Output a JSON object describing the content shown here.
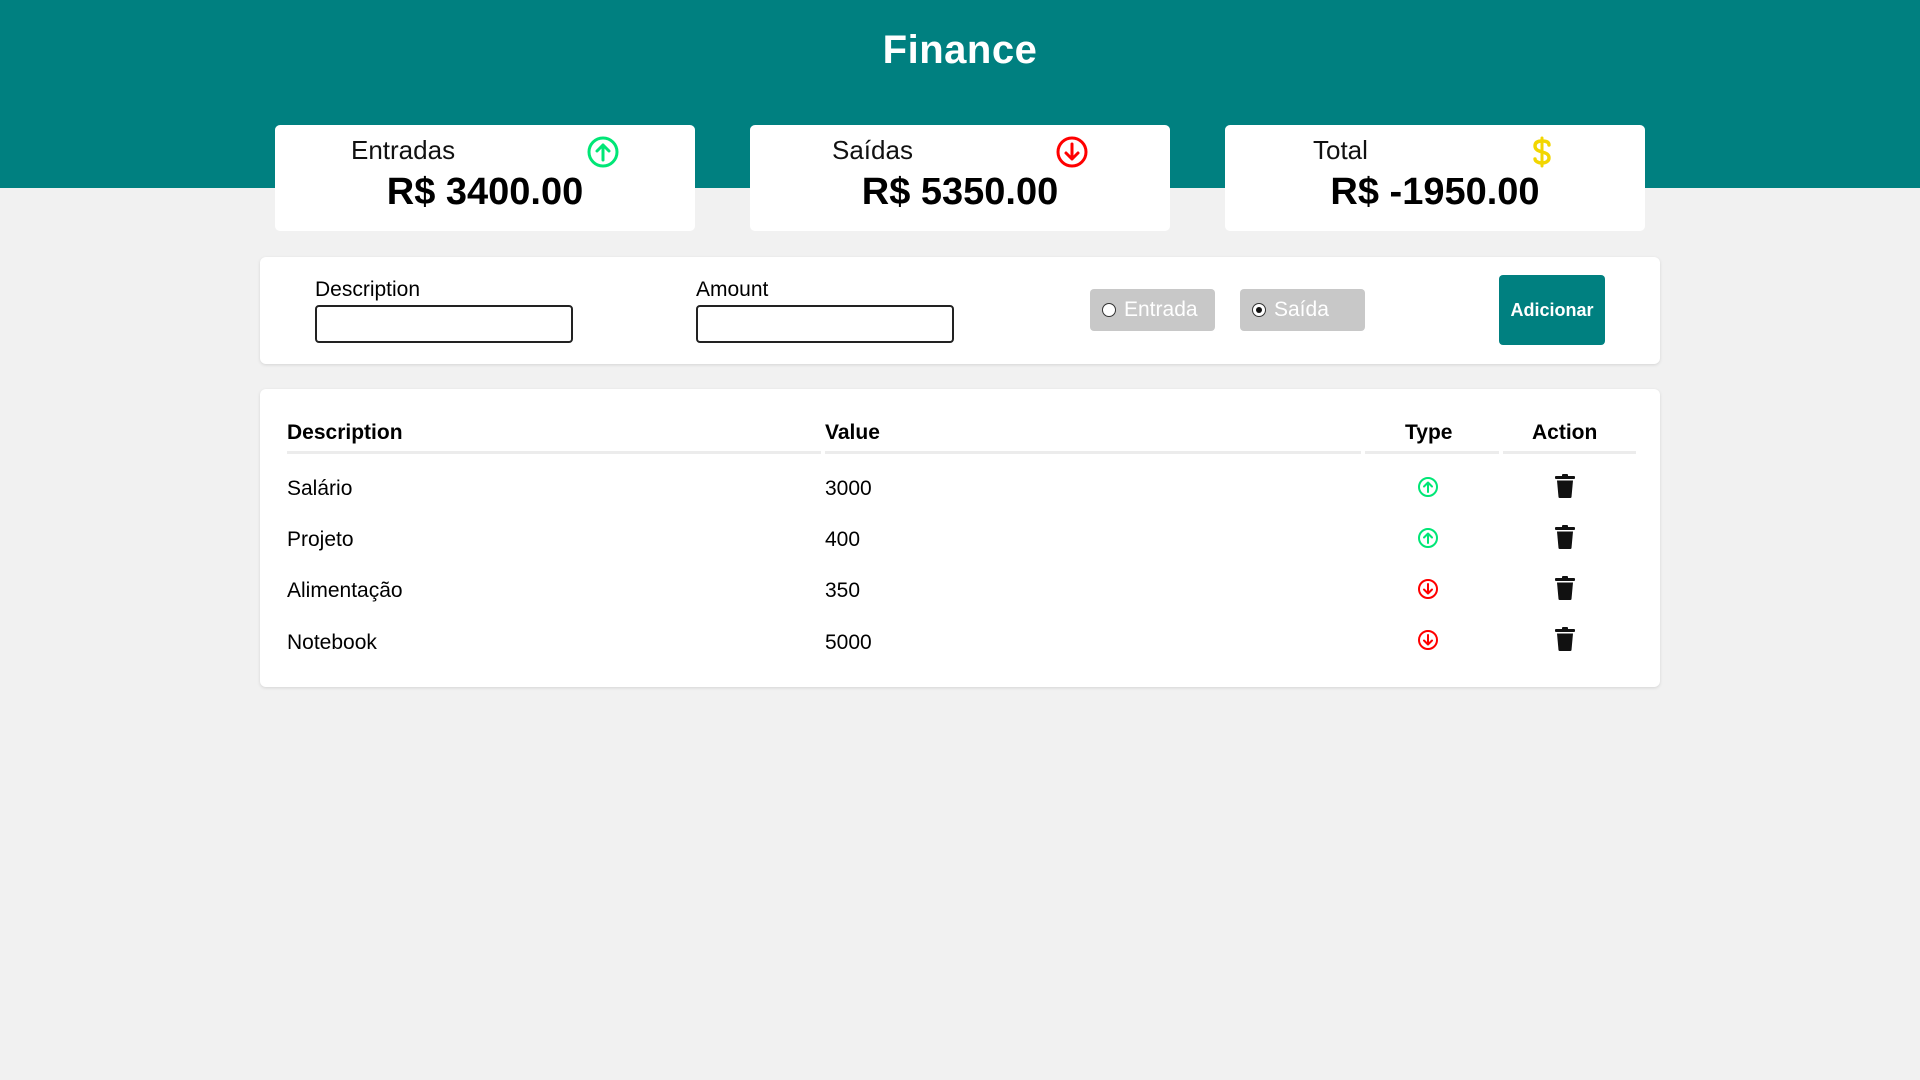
{
  "app": {
    "title": "Finance"
  },
  "summary": {
    "income": {
      "label": "Entradas",
      "value": "R$ 3400.00",
      "icon": "arrow-up-circle-icon",
      "color": "#00e676"
    },
    "expense": {
      "label": "Saídas",
      "value": "R$ 5350.00",
      "icon": "arrow-down-circle-icon",
      "color": "#ff0000"
    },
    "total": {
      "label": "Total",
      "value": "R$ -1950.00",
      "icon": "dollar-icon",
      "color": "#f2d600"
    }
  },
  "form": {
    "description_label": "Description",
    "description_value": "",
    "amount_label": "Amount",
    "amount_value": "",
    "radio_income_label": "Entrada",
    "radio_expense_label": "Saída",
    "selected_type": "Saída",
    "submit_label": "Adicionar"
  },
  "table": {
    "headers": {
      "description": "Description",
      "value": "Value",
      "type": "Type",
      "action": "Action"
    },
    "rows": [
      {
        "description": "Salário",
        "value": "3000",
        "type": "entrada",
        "type_icon": "arrow-up-circle-icon",
        "action_icon": "trash-icon"
      },
      {
        "description": "Projeto",
        "value": "400",
        "type": "entrada",
        "type_icon": "arrow-up-circle-icon",
        "action_icon": "trash-icon"
      },
      {
        "description": "Alimentação",
        "value": "350",
        "type": "saida",
        "type_icon": "arrow-down-circle-icon",
        "action_icon": "trash-icon"
      },
      {
        "description": "Notebook",
        "value": "5000",
        "type": "saida",
        "type_icon": "arrow-down-circle-icon",
        "action_icon": "trash-icon"
      }
    ]
  },
  "colors": {
    "brand": "#008080",
    "background": "#f1f1f1",
    "income": "#00e676",
    "expense": "#ff0000",
    "total_icon": "#f2d600",
    "radio_bg": "#c8c8c8"
  }
}
